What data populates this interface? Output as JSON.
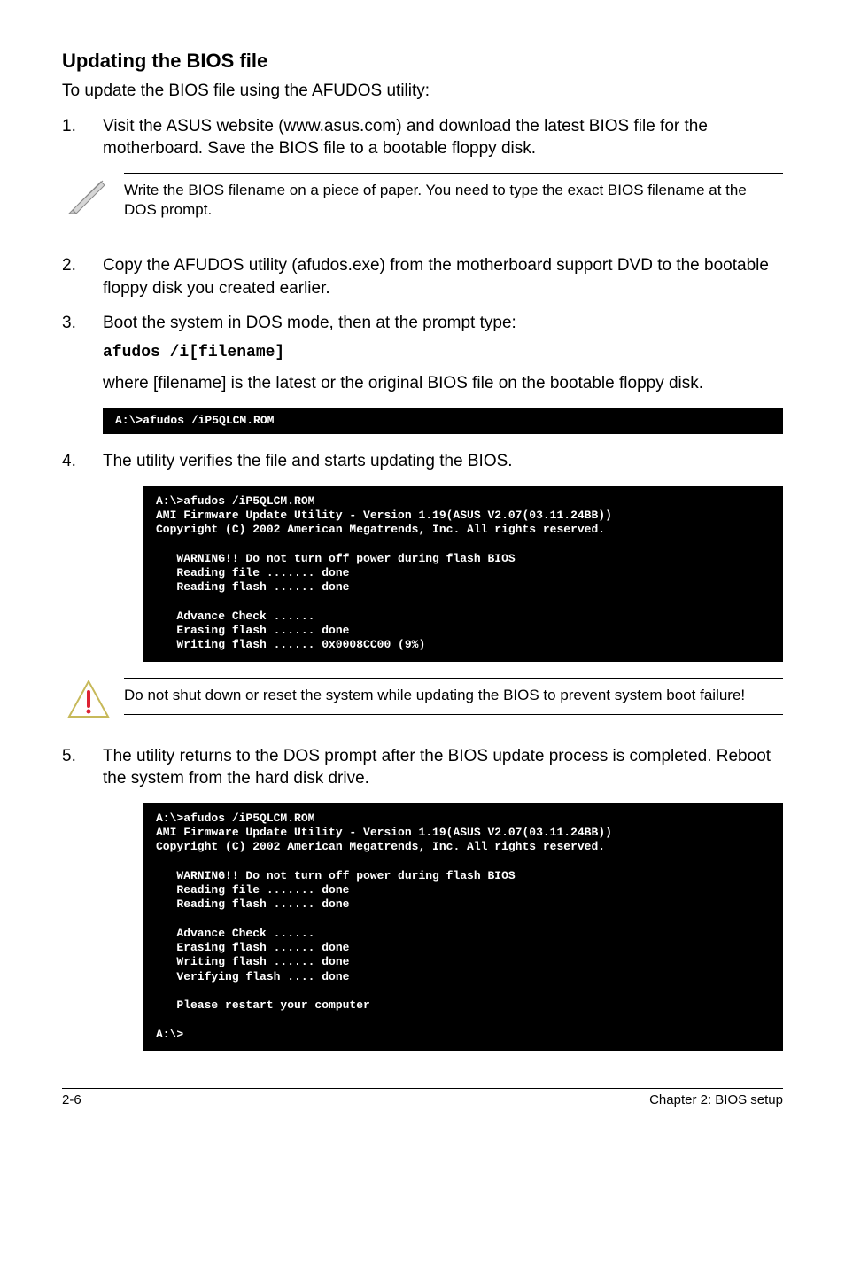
{
  "heading": "Updating the BIOS file",
  "intro": "To update the BIOS file using the AFUDOS utility:",
  "step1": {
    "num": "1.",
    "text": "Visit the ASUS website (www.asus.com) and download the latest BIOS file for the motherboard. Save the BIOS file to a bootable floppy disk."
  },
  "note1": "Write the BIOS filename on a piece of paper. You need to type the exact BIOS filename at the DOS prompt.",
  "step2": {
    "num": "2.",
    "text": "Copy the AFUDOS utility (afudos.exe) from the motherboard support DVD to the bootable floppy disk you created earlier."
  },
  "step3": {
    "num": "3.",
    "text_a": "Boot the system in DOS mode, then at the prompt type:",
    "cmd": "afudos /i[filename]",
    "text_b": "where [filename] is the latest or the original BIOS file on the bootable floppy disk."
  },
  "term1": "A:\\>afudos /iP5QLCM.ROM",
  "step4": {
    "num": "4.",
    "text": "The utility verifies the file and starts updating the BIOS."
  },
  "term2": "A:\\>afudos /iP5QLCM.ROM\nAMI Firmware Update Utility - Version 1.19(ASUS V2.07(03.11.24BB))\nCopyright (C) 2002 American Megatrends, Inc. All rights reserved.\n\n   WARNING!! Do not turn off power during flash BIOS\n   Reading file ....... done\n   Reading flash ...... done\n\n   Advance Check ......\n   Erasing flash ...... done\n   Writing flash ...... 0x0008CC00 (9%)",
  "note2": "Do not shut down or reset the system while updating the BIOS to prevent system boot failure!",
  "step5": {
    "num": "5.",
    "text": "The utility returns to the DOS prompt after the BIOS update process is completed. Reboot the system from the hard disk drive."
  },
  "term3": "A:\\>afudos /iP5QLCM.ROM\nAMI Firmware Update Utility - Version 1.19(ASUS V2.07(03.11.24BB))\nCopyright (C) 2002 American Megatrends, Inc. All rights reserved.\n\n   WARNING!! Do not turn off power during flash BIOS\n   Reading file ....... done\n   Reading flash ...... done\n\n   Advance Check ......\n   Erasing flash ...... done\n   Writing flash ...... done\n   Verifying flash .... done\n\n   Please restart your computer\n\nA:\\>",
  "footer_left": "2-6",
  "footer_right": "Chapter 2: BIOS setup"
}
